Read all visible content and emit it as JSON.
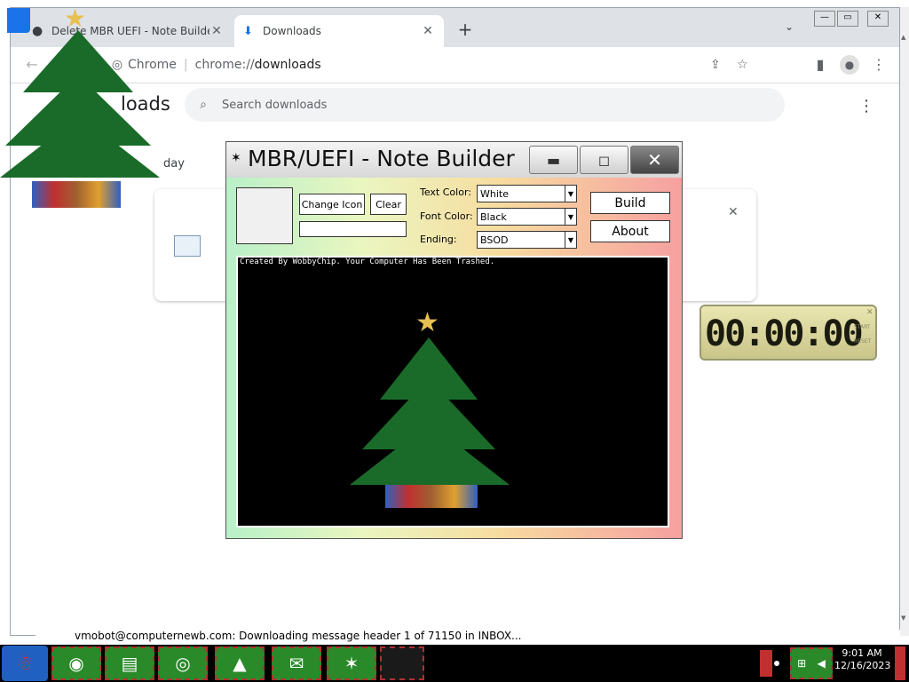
{
  "browser": {
    "tabs": [
      {
        "label": "Delete MBR UEFI - Note Builder",
        "icon": "github-icon"
      },
      {
        "label": "Downloads",
        "icon": "download-icon"
      }
    ],
    "new_tab": "+",
    "omnibox": {
      "site": "Chrome",
      "url_prefix": "chrome://",
      "url_path": "downloads"
    }
  },
  "downloads_page": {
    "title_partial": "loads",
    "search_placeholder": "Search downloads",
    "date_partial": "day"
  },
  "note_builder": {
    "title": "MBR/UEFI - Note Builder",
    "change_icon_label": "Change Icon",
    "clear_label": "Clear",
    "icon_path_value": "",
    "text_color_label": "Text Color:",
    "text_color_value": "White",
    "font_color_label": "Font Color:",
    "font_color_value": "Black",
    "ending_label": "Ending:",
    "ending_value": "BSOD",
    "build_label": "Build",
    "about_label": "About",
    "console_text": "Created By WobbyChip. Your Computer Has Been Trashed."
  },
  "timer": {
    "display": "00:00:00",
    "start_label": "START",
    "reset_label": "RESET"
  },
  "statusbar": {
    "text": "vmobot@computernewb.com: Downloading message header 1 of 71150 in INBOX..."
  },
  "taskbar": {
    "time": "9:01 AM",
    "date": "12/16/2023"
  },
  "colors": {
    "accent": "#1a73e8",
    "console_bg": "#000000",
    "taskbar_item": "#2a8a2a"
  }
}
